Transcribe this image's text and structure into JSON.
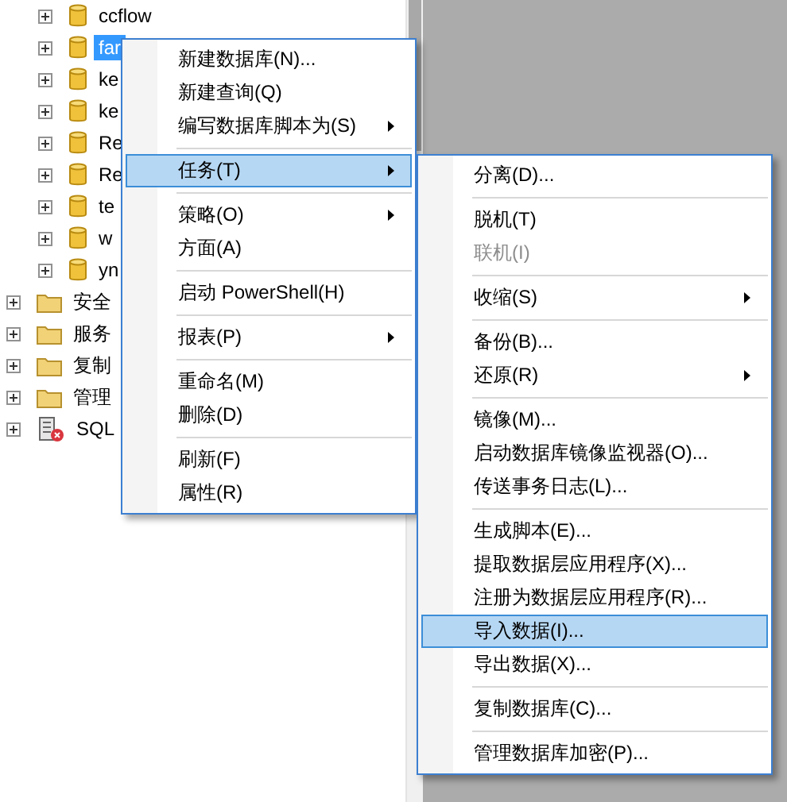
{
  "tree": {
    "items": [
      {
        "kind": "database",
        "label": "ccflow",
        "selected": false
      },
      {
        "kind": "database",
        "label": "far",
        "selected": true
      },
      {
        "kind": "database",
        "label": "ke",
        "selected": false
      },
      {
        "kind": "database",
        "label": "ke",
        "selected": false
      },
      {
        "kind": "database",
        "label": "Re",
        "selected": false
      },
      {
        "kind": "database",
        "label": "Re",
        "selected": false
      },
      {
        "kind": "database",
        "label": "te",
        "selected": false
      },
      {
        "kind": "database",
        "label": "w",
        "selected": false
      },
      {
        "kind": "database",
        "label": "yn",
        "selected": false
      },
      {
        "kind": "folder",
        "label": "安全",
        "selected": false
      },
      {
        "kind": "folder",
        "label": "服务",
        "selected": false
      },
      {
        "kind": "folder",
        "label": "复制",
        "selected": false
      },
      {
        "kind": "folder",
        "label": "管理",
        "selected": false
      },
      {
        "kind": "agent",
        "label": "SQL",
        "selected": false
      }
    ]
  },
  "context_menu": {
    "items": [
      {
        "kind": "item",
        "label": "新建数据库(N)...",
        "selected": false,
        "submenu": false
      },
      {
        "kind": "item",
        "label": "新建查询(Q)",
        "selected": false,
        "submenu": false
      },
      {
        "kind": "item",
        "label": "编写数据库脚本为(S)",
        "selected": false,
        "submenu": true
      },
      {
        "kind": "separator"
      },
      {
        "kind": "item",
        "label": "任务(T)",
        "selected": true,
        "submenu": true
      },
      {
        "kind": "separator"
      },
      {
        "kind": "item",
        "label": "策略(O)",
        "selected": false,
        "submenu": true
      },
      {
        "kind": "item",
        "label": "方面(A)",
        "selected": false,
        "submenu": false
      },
      {
        "kind": "separator"
      },
      {
        "kind": "item",
        "label": "启动 PowerShell(H)",
        "selected": false,
        "submenu": false
      },
      {
        "kind": "separator"
      },
      {
        "kind": "item",
        "label": "报表(P)",
        "selected": false,
        "submenu": true
      },
      {
        "kind": "separator"
      },
      {
        "kind": "item",
        "label": "重命名(M)",
        "selected": false,
        "submenu": false
      },
      {
        "kind": "item",
        "label": "删除(D)",
        "selected": false,
        "submenu": false
      },
      {
        "kind": "separator"
      },
      {
        "kind": "item",
        "label": "刷新(F)",
        "selected": false,
        "submenu": false
      },
      {
        "kind": "item",
        "label": "属性(R)",
        "selected": false,
        "submenu": false
      }
    ]
  },
  "tasks_submenu": {
    "items": [
      {
        "kind": "item",
        "label": "分离(D)...",
        "selected": false,
        "submenu": false,
        "disabled": false
      },
      {
        "kind": "separator"
      },
      {
        "kind": "item",
        "label": "脱机(T)",
        "selected": false,
        "submenu": false,
        "disabled": false
      },
      {
        "kind": "item",
        "label": "联机(I)",
        "selected": false,
        "submenu": false,
        "disabled": true
      },
      {
        "kind": "separator"
      },
      {
        "kind": "item",
        "label": "收缩(S)",
        "selected": false,
        "submenu": true,
        "disabled": false
      },
      {
        "kind": "separator"
      },
      {
        "kind": "item",
        "label": "备份(B)...",
        "selected": false,
        "submenu": false,
        "disabled": false
      },
      {
        "kind": "item",
        "label": "还原(R)",
        "selected": false,
        "submenu": true,
        "disabled": false
      },
      {
        "kind": "separator"
      },
      {
        "kind": "item",
        "label": "镜像(M)...",
        "selected": false,
        "submenu": false,
        "disabled": false
      },
      {
        "kind": "item",
        "label": "启动数据库镜像监视器(O)...",
        "selected": false,
        "submenu": false,
        "disabled": false
      },
      {
        "kind": "item",
        "label": "传送事务日志(L)...",
        "selected": false,
        "submenu": false,
        "disabled": false
      },
      {
        "kind": "separator"
      },
      {
        "kind": "item",
        "label": "生成脚本(E)...",
        "selected": false,
        "submenu": false,
        "disabled": false
      },
      {
        "kind": "item",
        "label": "提取数据层应用程序(X)...",
        "selected": false,
        "submenu": false,
        "disabled": false
      },
      {
        "kind": "item",
        "label": "注册为数据层应用程序(R)...",
        "selected": false,
        "submenu": false,
        "disabled": false
      },
      {
        "kind": "item",
        "label": "导入数据(I)...",
        "selected": true,
        "submenu": false,
        "disabled": false
      },
      {
        "kind": "item",
        "label": "导出数据(X)...",
        "selected": false,
        "submenu": false,
        "disabled": false
      },
      {
        "kind": "separator"
      },
      {
        "kind": "item",
        "label": "复制数据库(C)...",
        "selected": false,
        "submenu": false,
        "disabled": false
      },
      {
        "kind": "separator"
      },
      {
        "kind": "item",
        "label": "管理数据库加密(P)...",
        "selected": false,
        "submenu": false,
        "disabled": false
      }
    ]
  }
}
